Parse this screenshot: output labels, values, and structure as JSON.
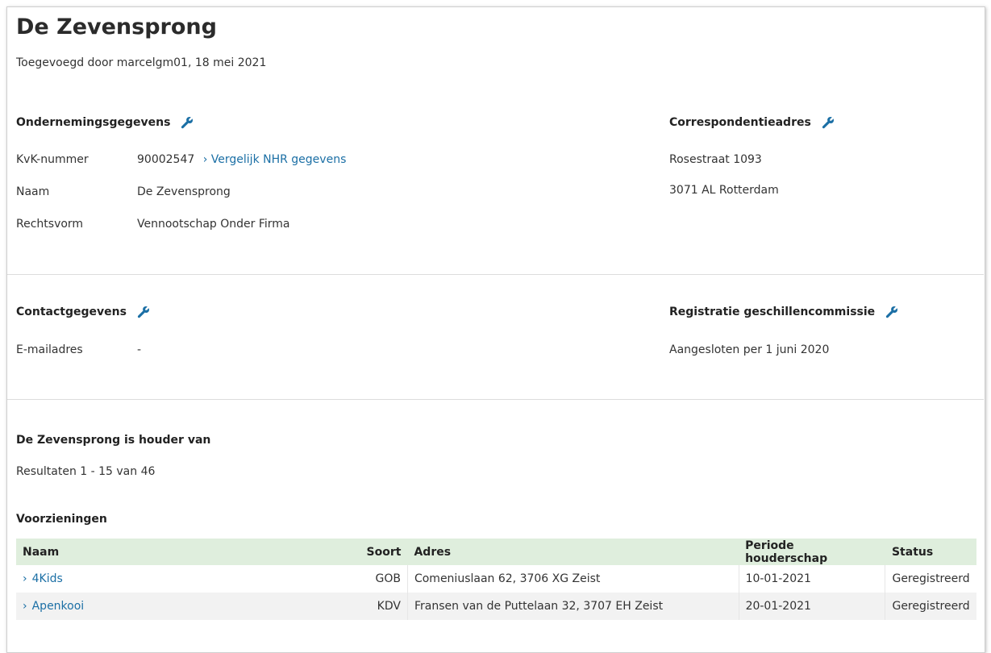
{
  "page": {
    "title": "De Zevensprong",
    "added_by": "Toegevoegd door marcelgm01, 18 mei 2021"
  },
  "company": {
    "heading": "Ondernemingsgegevens",
    "kvk_label": "KvK-nummer",
    "kvk_value": "90002547",
    "compare_link": "Vergelijk NHR gegevens",
    "name_label": "Naam",
    "name_value": "De Zevensprong",
    "legal_label": "Rechtsvorm",
    "legal_value": "Vennootschap Onder Firma"
  },
  "correspondence": {
    "heading": "Correspondentieadres",
    "line1": "Rosestraat 1093",
    "line2": "3071 AL Rotterdam"
  },
  "contact": {
    "heading": "Contactgegevens",
    "email_label": "E-mailadres",
    "email_value": "-"
  },
  "dispute": {
    "heading": "Registratie geschillencommissie",
    "value": "Aangesloten per 1 juni 2020"
  },
  "holder": {
    "heading": "De Zevensprong is houder van",
    "results": "Resultaten 1 - 15 van 46",
    "facilities_heading": "Voorzieningen"
  },
  "table": {
    "headers": [
      "Naam",
      "Soort",
      "Adres",
      "Periode houderschap",
      "Status"
    ],
    "rows": [
      {
        "naam": "4Kids",
        "soort": "GOB",
        "adres": "Comeniuslaan 62, 3706 XG Zeist",
        "periode": "10-01-2021",
        "status": "Geregistreerd"
      },
      {
        "naam": "Apenkooi",
        "soort": "KDV",
        "adres": "Fransen van de Puttelaan 32, 3707 EH Zeist",
        "periode": "20-01-2021",
        "status": "Geregistreerd"
      }
    ]
  },
  "icons": {
    "edit": "wrench-icon",
    "row_link": "chevron-right-icon"
  },
  "colors": {
    "link": "#1b6fa5",
    "table_header_bg": "#dfeedd",
    "icon": "#1b6fa5"
  }
}
